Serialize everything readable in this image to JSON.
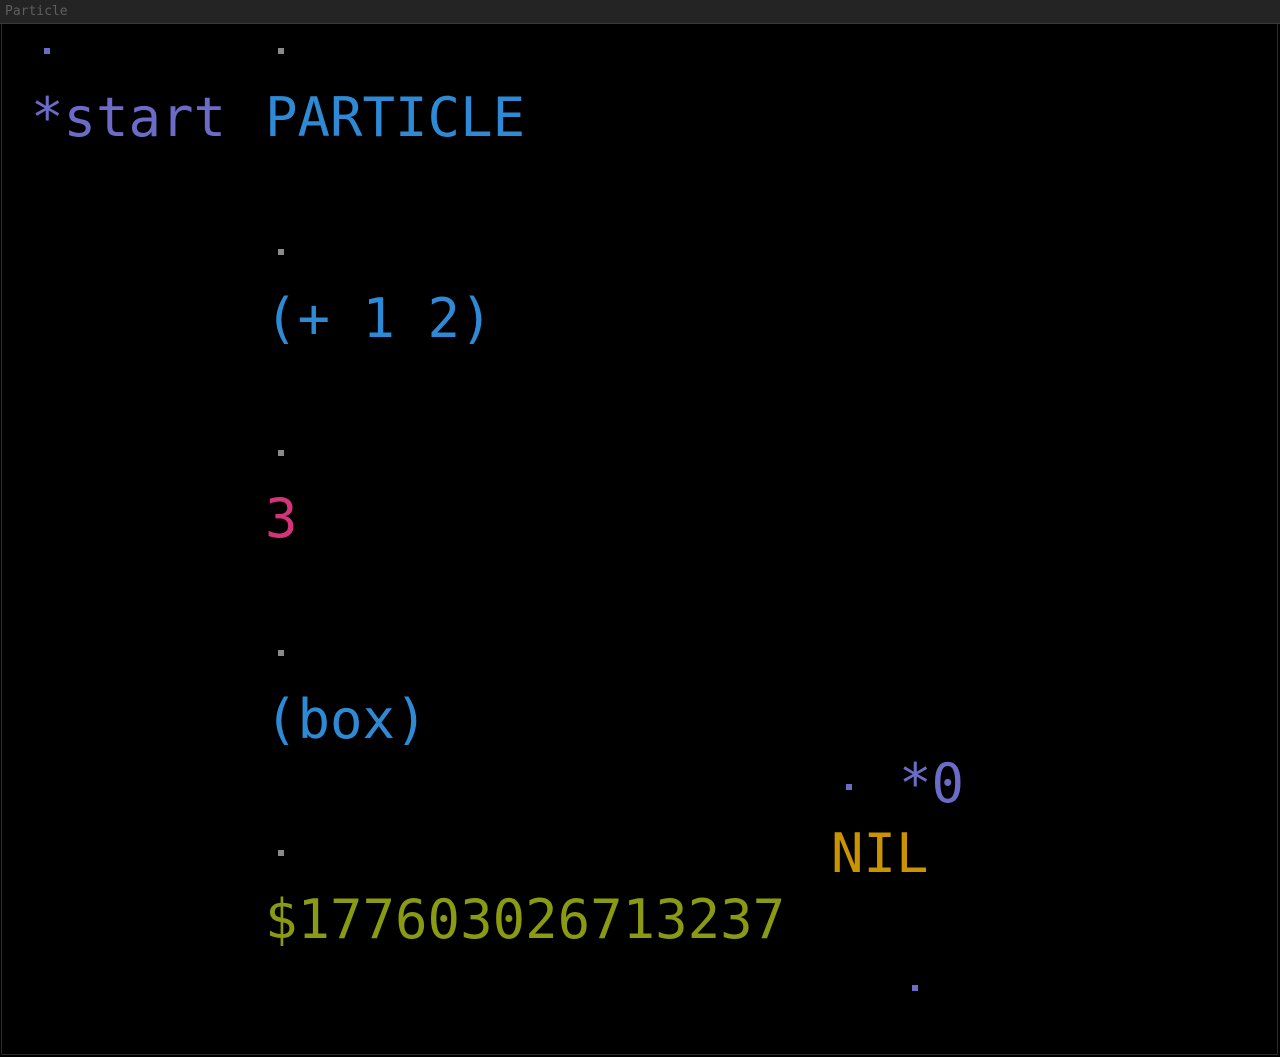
{
  "window": {
    "title": "Particle"
  },
  "nodes": {
    "start_marker": "*start",
    "start_name": "PARTICLE",
    "expr_1": "(+ 1 2)",
    "result_1": "3",
    "expr_2": "(box)",
    "result_2": "$177603026713237",
    "box_marker": "*0",
    "box_value": "NIL"
  },
  "colors": {
    "background": "#000000",
    "titlebar": "#242424",
    "symbol": "#6c6cc8",
    "expression": "#2f8ad6",
    "number": "#d6337b",
    "box_address": "#8a9a12",
    "nil": "#c99400",
    "connector_dot": "#8a8a8a"
  }
}
